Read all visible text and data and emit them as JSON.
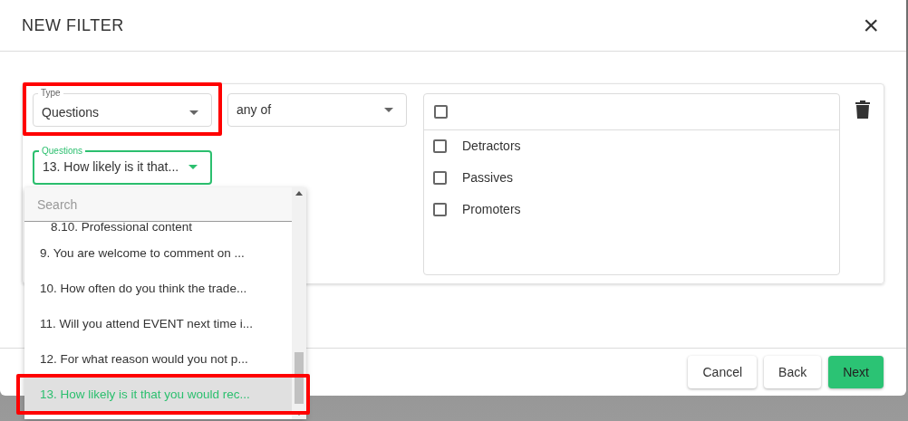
{
  "modal": {
    "title": "NEW FILTER",
    "close": "×"
  },
  "type_field": {
    "label": "Type",
    "value": "Questions",
    "highlighted": true
  },
  "operator_field": {
    "value": "any of"
  },
  "questions_field": {
    "label": "Questions",
    "value": "13. How likely is it that...",
    "focused": true
  },
  "options_panel": {
    "select_all_checked": false,
    "options": [
      {
        "label": "Detractors",
        "checked": false
      },
      {
        "label": "Passives",
        "checked": false
      },
      {
        "label": "Promoters",
        "checked": false
      }
    ]
  },
  "dropdown": {
    "placeholder": "Search",
    "items": [
      {
        "label": "8.10. Professional content",
        "kind": "subitem",
        "selected": false,
        "highlighted": false
      },
      {
        "label": "9. You are welcome to comment on ...",
        "kind": "item",
        "selected": false,
        "highlighted": false
      },
      {
        "label": "10. How often do you think the trade...",
        "kind": "item",
        "selected": false,
        "highlighted": false
      },
      {
        "label": "11. Will you attend EVENT next time i...",
        "kind": "item",
        "selected": false,
        "highlighted": false
      },
      {
        "label": "12. For what reason would you not p...",
        "kind": "item",
        "selected": false,
        "highlighted": false
      },
      {
        "label": "13. How likely is it that you would rec...",
        "kind": "item",
        "selected": true,
        "highlighted": true
      }
    ]
  },
  "buttons": [
    {
      "label": "Cancel",
      "kind": "secondary"
    },
    {
      "label": "Back",
      "kind": "secondary"
    },
    {
      "label": "Next",
      "kind": "primary"
    }
  ]
}
